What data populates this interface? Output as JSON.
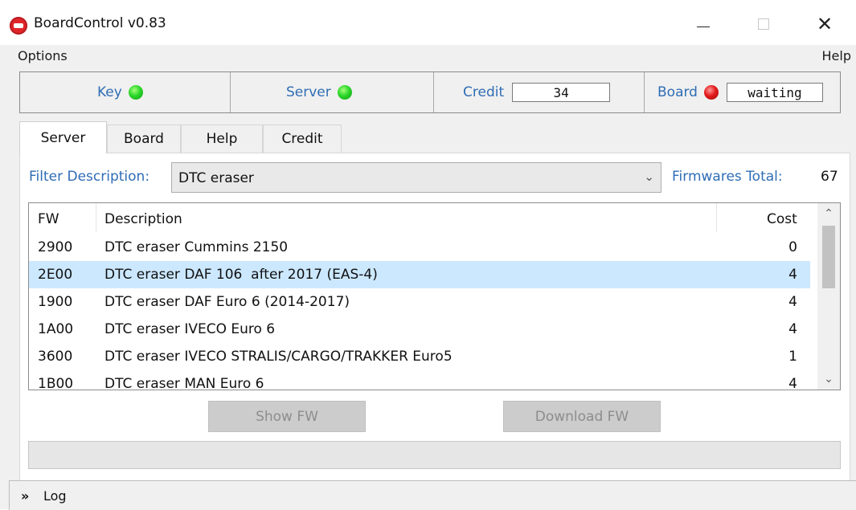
{
  "window": {
    "title": "BoardControl v0.83",
    "icon": "app-logo-icon",
    "controls": {
      "minimize": "—",
      "maximize": "☐",
      "close": "✕"
    }
  },
  "menu": {
    "options": "Options",
    "help": "Help"
  },
  "status": {
    "key_label": "Key",
    "key_state": "green",
    "server_label": "Server",
    "server_state": "green",
    "credit_label": "Credit",
    "credit_value": "34",
    "board_label": "Board",
    "board_state": "red",
    "board_value": "waiting"
  },
  "tabs": [
    {
      "label": "Server",
      "active": true
    },
    {
      "label": "Board",
      "active": false
    },
    {
      "label": "Help",
      "active": false
    },
    {
      "label": "Credit",
      "active": false
    }
  ],
  "filter": {
    "label": "Filter Description:",
    "value": "DTC eraser",
    "firmwares_total_label": "Firmwares Total:",
    "firmwares_total_value": "67"
  },
  "table": {
    "headers": {
      "fw": "FW",
      "description": "Description",
      "cost": "Cost"
    },
    "rows": [
      {
        "fw": "2900",
        "description": "DTC eraser Cummins 2150",
        "cost": "0",
        "selected": false
      },
      {
        "fw": "2E00",
        "description": "DTC eraser DAF 106  after 2017 (EAS-4)",
        "cost": "4",
        "selected": true
      },
      {
        "fw": "1900",
        "description": "DTC eraser DAF Euro 6 (2014-2017)",
        "cost": "4",
        "selected": false
      },
      {
        "fw": "1A00",
        "description": "DTC eraser IVECO Euro 6",
        "cost": "4",
        "selected": false
      },
      {
        "fw": "3600",
        "description": "DTC eraser IVECO STRALIS/CARGO/TRAKKER Euro5",
        "cost": "1",
        "selected": false
      },
      {
        "fw": "1B00",
        "description": "DTC eraser MAN Euro 6",
        "cost": "4",
        "selected": false
      }
    ]
  },
  "buttons": {
    "show_fw": "Show FW",
    "download_fw": "Download FW"
  },
  "progress": {
    "value": 0
  },
  "log": {
    "arrows": "»",
    "label": "Log"
  },
  "colors": {
    "accent_text": "#2f6db5",
    "led_green": "#2bd62b",
    "led_red": "#e31b1b",
    "selected_row": "#cce8ff"
  }
}
